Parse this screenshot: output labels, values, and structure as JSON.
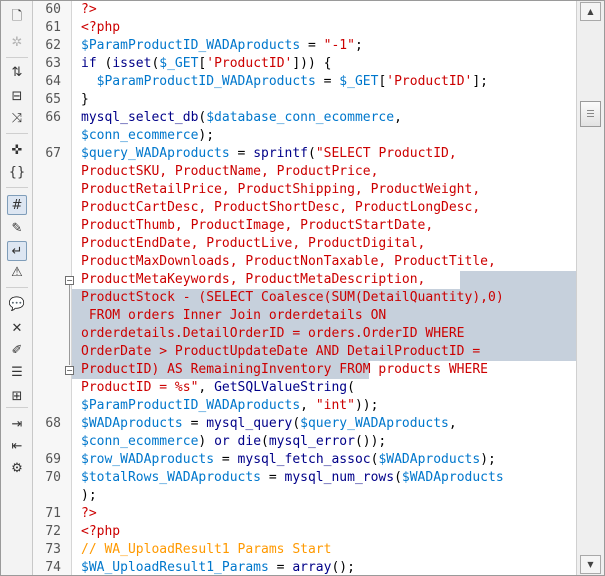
{
  "toolbar": {
    "buttons": [
      {
        "name": "open-documents-icon",
        "glyph": "🗋"
      },
      {
        "name": "show-code-navigator-icon",
        "glyph": "✲"
      },
      {
        "name": "collapse-full-tag-icon",
        "glyph": "⇅"
      },
      {
        "name": "collapse-selection-icon",
        "glyph": "⊟"
      },
      {
        "name": "expand-all-icon",
        "glyph": "⤨"
      },
      {
        "name": "select-parent-tag-icon",
        "glyph": "✜"
      },
      {
        "name": "balance-braces-icon",
        "glyph": "{}"
      },
      {
        "name": "line-numbers-icon",
        "glyph": "#"
      },
      {
        "name": "highlight-invalid-code-icon",
        "glyph": "✎"
      },
      {
        "name": "word-wrap-icon",
        "glyph": "↵"
      },
      {
        "name": "syntax-error-alerts-icon",
        "glyph": "⚠"
      },
      {
        "name": "apply-comment-icon",
        "glyph": "💬"
      },
      {
        "name": "remove-comment-icon",
        "glyph": "✕"
      },
      {
        "name": "wrap-tag-icon",
        "glyph": "✐"
      },
      {
        "name": "recent-snippets-icon",
        "glyph": "☰"
      },
      {
        "name": "move-css-icon",
        "glyph": "⊞"
      },
      {
        "name": "indent-code-icon",
        "glyph": "⇥"
      },
      {
        "name": "outdent-code-icon",
        "glyph": "⇤"
      },
      {
        "name": "format-source-code-icon",
        "glyph": "⚙"
      }
    ]
  },
  "editor": {
    "line_numbers": [
      {
        "n": "60",
        "row": 0
      },
      {
        "n": "61",
        "row": 1
      },
      {
        "n": "62",
        "row": 2
      },
      {
        "n": "63",
        "row": 3
      },
      {
        "n": "64",
        "row": 4
      },
      {
        "n": "65",
        "row": 5
      },
      {
        "n": "66",
        "row": 6
      },
      {
        "n": "67",
        "row": 8
      },
      {
        "n": "68",
        "row": 23
      },
      {
        "n": "69",
        "row": 25
      },
      {
        "n": "70",
        "row": 26
      },
      {
        "n": "71",
        "row": 28
      },
      {
        "n": "72",
        "row": 29
      },
      {
        "n": "73",
        "row": 30
      },
      {
        "n": "74",
        "row": 31
      }
    ],
    "lines": [
      [
        {
          "t": "?>",
          "c": "tag"
        }
      ],
      [
        {
          "t": "<?php",
          "c": "tag"
        }
      ],
      [
        {
          "t": "$ParamProductID_WADAproducts",
          "c": "var"
        },
        {
          "t": " = ",
          "c": ""
        },
        {
          "t": "\"-1\"",
          "c": "str"
        },
        {
          "t": ";",
          "c": ""
        }
      ],
      [
        {
          "t": "if",
          "c": "kw"
        },
        {
          "t": " (",
          "c": ""
        },
        {
          "t": "isset",
          "c": "kw"
        },
        {
          "t": "(",
          "c": ""
        },
        {
          "t": "$_GET",
          "c": "var"
        },
        {
          "t": "[",
          "c": ""
        },
        {
          "t": "'ProductID'",
          "c": "str"
        },
        {
          "t": "])) {",
          "c": ""
        }
      ],
      [
        {
          "t": "  ",
          "c": ""
        },
        {
          "t": "$ParamProductID_WADAproducts",
          "c": "var"
        },
        {
          "t": " = ",
          "c": ""
        },
        {
          "t": "$_GET",
          "c": "var"
        },
        {
          "t": "[",
          "c": ""
        },
        {
          "t": "'ProductID'",
          "c": "str"
        },
        {
          "t": "];",
          "c": ""
        }
      ],
      [
        {
          "t": "}",
          "c": ""
        }
      ],
      [
        {
          "t": "mysql_select_db",
          "c": "kw"
        },
        {
          "t": "(",
          "c": ""
        },
        {
          "t": "$database_conn_ecommerce",
          "c": "var"
        },
        {
          "t": ",",
          "c": ""
        }
      ],
      [
        {
          "t": "$conn_ecommerce",
          "c": "var"
        },
        {
          "t": ");",
          "c": ""
        }
      ],
      [
        {
          "t": "$query_WADAproducts",
          "c": "var"
        },
        {
          "t": " = ",
          "c": ""
        },
        {
          "t": "sprintf",
          "c": "kw"
        },
        {
          "t": "(",
          "c": ""
        },
        {
          "t": "\"SELECT ProductID,",
          "c": "str"
        }
      ],
      [
        {
          "t": "ProductSKU, ProductName, ProductPrice,",
          "c": "str"
        }
      ],
      [
        {
          "t": "ProductRetailPrice, ProductShipping, ProductWeight,",
          "c": "str"
        }
      ],
      [
        {
          "t": "ProductCartDesc, ProductShortDesc, ProductLongDesc,",
          "c": "str"
        }
      ],
      [
        {
          "t": "ProductThumb, ProductImage, ProductStartDate,",
          "c": "str"
        }
      ],
      [
        {
          "t": "ProductEndDate, ProductLive, ProductDigital,",
          "c": "str"
        }
      ],
      [
        {
          "t": "ProductMaxDownloads, ProductNonTaxable, ProductTitle,",
          "c": "str"
        }
      ],
      [
        {
          "t": "ProductMetaKeywords, ProductMetaDescription",
          "c": "str"
        },
        {
          "t": ",",
          "c": "str"
        }
      ],
      [
        {
          "t": "ProductStock - (SELECT Coalesce(SUM(DetailQuantity),0)",
          "c": "str"
        }
      ],
      [
        {
          "t": " FROM orders Inner Join orderdetails ON",
          "c": "str"
        }
      ],
      [
        {
          "t": "orderdetails.DetailOrderID = orders.OrderID WHERE",
          "c": "str"
        }
      ],
      [
        {
          "t": "OrderDate > ProductUpdateDate AND DetailProductID =",
          "c": "str"
        }
      ],
      [
        {
          "t": "ProductID) AS RemainingInventory",
          "c": "str"
        },
        {
          "t": " FROM products WHERE",
          "c": "str"
        }
      ],
      [
        {
          "t": "ProductID = %s\"",
          "c": "str"
        },
        {
          "t": ", ",
          "c": ""
        },
        {
          "t": "GetSQLValueString",
          "c": "kw"
        },
        {
          "t": "(",
          "c": ""
        }
      ],
      [
        {
          "t": "$ParamProductID_WADAproducts",
          "c": "var"
        },
        {
          "t": ", ",
          "c": ""
        },
        {
          "t": "\"int\"",
          "c": "str"
        },
        {
          "t": "));",
          "c": ""
        }
      ],
      [
        {
          "t": "$WADAproducts",
          "c": "var"
        },
        {
          "t": " = ",
          "c": ""
        },
        {
          "t": "mysql_query",
          "c": "kw"
        },
        {
          "t": "(",
          "c": ""
        },
        {
          "t": "$query_WADAproducts",
          "c": "var"
        },
        {
          "t": ",",
          "c": ""
        }
      ],
      [
        {
          "t": "$conn_ecommerce",
          "c": "var"
        },
        {
          "t": ") ",
          "c": ""
        },
        {
          "t": "or",
          "c": "kw"
        },
        {
          "t": " ",
          "c": ""
        },
        {
          "t": "die",
          "c": "kw"
        },
        {
          "t": "(",
          "c": ""
        },
        {
          "t": "mysql_error",
          "c": "kw"
        },
        {
          "t": "());",
          "c": ""
        }
      ],
      [
        {
          "t": "$row_WADAproducts",
          "c": "var"
        },
        {
          "t": " = ",
          "c": ""
        },
        {
          "t": "mysql_fetch_assoc",
          "c": "kw"
        },
        {
          "t": "(",
          "c": ""
        },
        {
          "t": "$WADAproducts",
          "c": "var"
        },
        {
          "t": ");",
          "c": ""
        }
      ],
      [
        {
          "t": "$totalRows_WADAproducts",
          "c": "var"
        },
        {
          "t": " = ",
          "c": ""
        },
        {
          "t": "mysql_num_rows",
          "c": "kw"
        },
        {
          "t": "(",
          "c": ""
        },
        {
          "t": "$WADAproducts",
          "c": "var"
        }
      ],
      [
        {
          "t": ");",
          "c": ""
        }
      ],
      [
        {
          "t": "?>",
          "c": "tag"
        }
      ],
      [
        {
          "t": "<?php",
          "c": "tag"
        }
      ],
      [
        {
          "t": "// WA_UploadResult1 Params Start",
          "c": "com"
        }
      ],
      [
        {
          "t": "$WA_UploadResult1_Params",
          "c": "var"
        },
        {
          "t": " = ",
          "c": ""
        },
        {
          "t": "array",
          "c": "kw"
        },
        {
          "t": "();",
          "c": ""
        }
      ]
    ]
  }
}
